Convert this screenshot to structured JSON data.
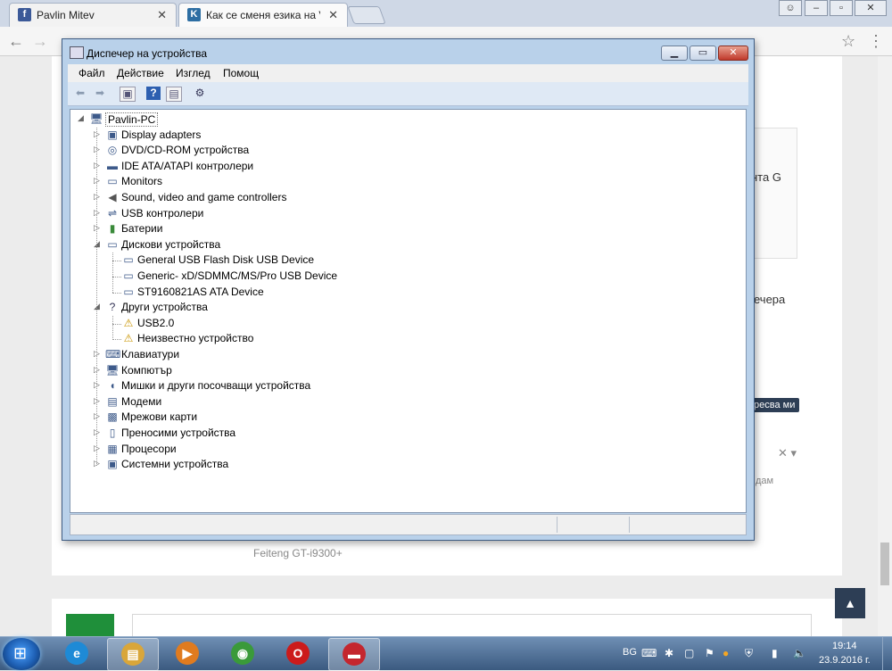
{
  "browser": {
    "tabs": [
      {
        "title": "Pavlin Mitev",
        "favicon": "f",
        "favicon_color": "#3b5998",
        "close": "✕"
      },
      {
        "title": "Как се сменя езика на V",
        "favicon": "K",
        "favicon_color": "#2d6ea3",
        "close": "✕"
      }
    ],
    "window_controls": {
      "minimize": "–",
      "maximize": "▫",
      "close": "✕"
    },
    "user_icon": "user-icon",
    "nav": {
      "back": "←",
      "forward": "→",
      "star": "☆",
      "menu": "⋮"
    }
  },
  "page": {
    "texts": [
      {
        "key": "frag_g",
        "text": "нта G"
      },
      {
        "key": "frag_vechera",
        "text": "ечера"
      },
      {
        "key": "frag_badge",
        "text": "ресва ми"
      },
      {
        "key": "frag_dam",
        "text": "дам"
      },
      {
        "key": "feiteng",
        "text": "Feiteng GT-i9300+"
      }
    ],
    "scroll_top_button": "▲"
  },
  "device_manager": {
    "title": "Диспечер на устройства",
    "controls": {
      "minimize": "▁",
      "maximize": "▭",
      "close": "✕"
    },
    "menu": [
      "Файл",
      "Действие",
      "Изглед",
      "Помощ"
    ],
    "toolbar_icons": [
      "back-arrow-icon",
      "forward-arrow-icon",
      "properties-icon",
      "help-icon",
      "view-icon",
      "scan-hardware-icon"
    ],
    "root": {
      "label": "Pavlin-PC",
      "icon": "computer-icon"
    },
    "tree": [
      {
        "label": "Display adapters",
        "icon": "display-adapter-icon",
        "expanded": false,
        "children": []
      },
      {
        "label": "DVD/CD-ROM устройства",
        "icon": "dvd-drive-icon",
        "expanded": false,
        "children": []
      },
      {
        "label": "IDE ATA/ATAPI контролери",
        "icon": "ide-controller-icon",
        "expanded": false,
        "children": []
      },
      {
        "label": "Monitors",
        "icon": "monitor-icon",
        "expanded": false,
        "children": []
      },
      {
        "label": "Sound, video and game controllers",
        "icon": "speaker-icon",
        "expanded": false,
        "children": []
      },
      {
        "label": "USB контролери",
        "icon": "usb-icon",
        "expanded": false,
        "children": []
      },
      {
        "label": "Батерии",
        "icon": "battery-icon",
        "expanded": false,
        "children": []
      },
      {
        "label": "Дискови устройства",
        "icon": "disk-drive-icon",
        "expanded": true,
        "children": [
          {
            "label": "General USB Flash Disk USB Device",
            "icon": "disk-drive-icon"
          },
          {
            "label": "Generic- xD/SDMMC/MS/Pro USB Device",
            "icon": "disk-drive-icon"
          },
          {
            "label": "ST9160821AS ATA Device",
            "icon": "disk-drive-icon"
          }
        ]
      },
      {
        "label": "Други устройства",
        "icon": "unknown-device-icon",
        "expanded": true,
        "children": [
          {
            "label": "USB2.0",
            "icon": "warning-device-icon"
          },
          {
            "label": "Неизвестно устройство",
            "icon": "warning-device-icon"
          }
        ]
      },
      {
        "label": "Клавиатури",
        "icon": "keyboard-icon",
        "expanded": false,
        "children": []
      },
      {
        "label": "Компютър",
        "icon": "computer-icon",
        "expanded": false,
        "children": []
      },
      {
        "label": "Мишки и други посочващи устройства",
        "icon": "mouse-icon",
        "expanded": false,
        "children": []
      },
      {
        "label": "Модеми",
        "icon": "modem-icon",
        "expanded": false,
        "children": []
      },
      {
        "label": "Мрежови карти",
        "icon": "network-adapter-icon",
        "expanded": false,
        "children": []
      },
      {
        "label": "Преносими устройства",
        "icon": "portable-device-icon",
        "expanded": false,
        "children": []
      },
      {
        "label": "Процесори",
        "icon": "processor-icon",
        "expanded": false,
        "children": []
      },
      {
        "label": "Системни устройства",
        "icon": "system-device-icon",
        "expanded": false,
        "children": []
      }
    ]
  },
  "taskbar": {
    "start": "start-orb-icon",
    "apps": [
      {
        "name": "ie",
        "glyph": "e",
        "color": "#1e8ad6"
      },
      {
        "name": "explorer",
        "glyph": "▤",
        "color": "#d9a63a"
      },
      {
        "name": "media",
        "glyph": "▶",
        "color": "#e07b1f"
      },
      {
        "name": "chrome",
        "glyph": "◉",
        "color": "#3a9a3a"
      },
      {
        "name": "opera",
        "glyph": "O",
        "color": "#cc1b1b"
      },
      {
        "name": "toolbox",
        "glyph": "▬",
        "color": "#c4262e"
      }
    ],
    "language": "BG",
    "time": "19:14",
    "date": "23.9.2016 г."
  }
}
